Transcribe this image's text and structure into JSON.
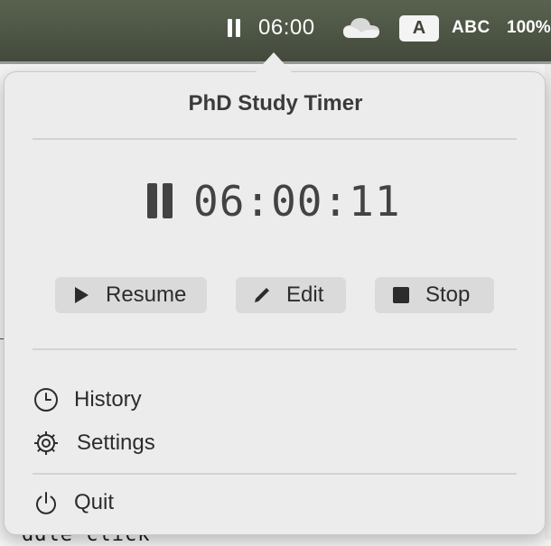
{
  "menubar": {
    "timer_text": "06:00",
    "input_source_letter": "A",
    "keyboard_layout": "ABC",
    "battery_text": "100%"
  },
  "popover": {
    "title": "PhD Study Timer",
    "timer_display": "06:00:11",
    "buttons": {
      "resume": "Resume",
      "edit": "Edit",
      "stop": "Stop"
    },
    "menu": {
      "history": "History",
      "settings": "Settings",
      "quit": "Quit"
    }
  },
  "background": {
    "partial_text": "ddle click"
  },
  "icons": {
    "menubar_pause": "pause-icon",
    "menubar_cloud": "cloud-icon",
    "timer_pause": "pause-icon",
    "resume": "play-icon",
    "edit": "pencil-icon",
    "stop": "stop-icon",
    "history": "clock-icon",
    "settings": "gear-icon",
    "quit": "power-icon"
  },
  "colors": {
    "menubar_bg": "#4e5745",
    "popover_bg": "#ececec",
    "button_bg": "#dadada",
    "text_dark": "#2c2c2c"
  }
}
